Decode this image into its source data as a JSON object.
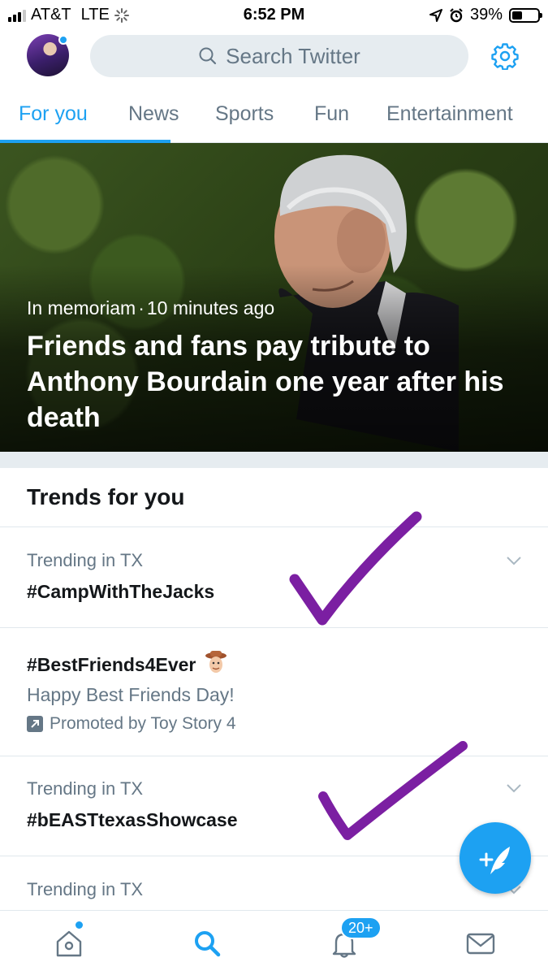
{
  "status_bar": {
    "carrier": "AT&T",
    "network": "LTE",
    "time": "6:52 PM",
    "battery_percent": "39%",
    "battery_level": 0.39,
    "signal_bars_active": 3,
    "signal_bars_total": 4
  },
  "header": {
    "search_placeholder": "Search Twitter",
    "avatar_icon": "avatar",
    "settings_icon": "gear-icon"
  },
  "tabs": [
    {
      "label": "For you",
      "active": true
    },
    {
      "label": "News",
      "active": false
    },
    {
      "label": "Sports",
      "active": false
    },
    {
      "label": "Fun",
      "active": false
    },
    {
      "label": "Entertainment",
      "active": false
    }
  ],
  "hero": {
    "category": "In memoriam",
    "separator": "·",
    "time": "10 minutes ago",
    "headline": "Friends and fans pay tribute to Anthony Bourdain one year after his death"
  },
  "trends": {
    "title": "Trends for you",
    "items": [
      {
        "context": "Trending in TX",
        "name": "#CampWithTheJacks"
      },
      {
        "name": "#BestFriends4Ever",
        "description": "Happy Best Friends Day!",
        "promoted": "Promoted by Toy Story 4"
      },
      {
        "context": "Trending in TX",
        "name": "#bEASTtexasShowcase"
      },
      {
        "context": "Trending in TX"
      }
    ]
  },
  "bottom_nav": {
    "items": [
      "home-icon",
      "search-icon",
      "notifications-icon",
      "messages-icon"
    ],
    "notifications_badge": "20+"
  },
  "colors": {
    "accent": "#1da1f2",
    "annotation": "#7b1fa2",
    "muted_text": "#657786"
  }
}
